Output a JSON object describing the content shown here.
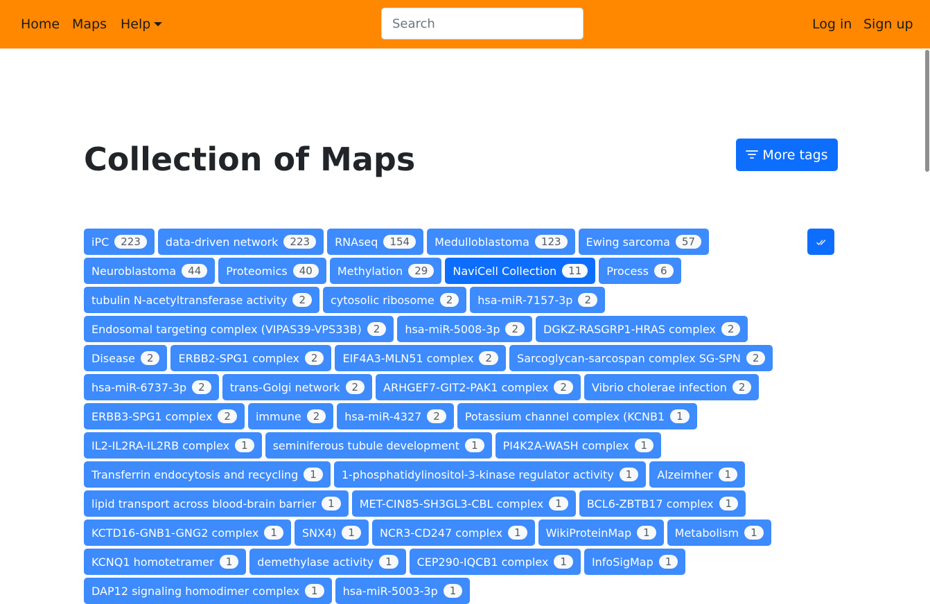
{
  "navbar": {
    "home": "Home",
    "maps": "Maps",
    "help": "Help",
    "search_placeholder": "Search",
    "login": "Log in",
    "signup": "Sign up",
    "bg_color": "#ff8800"
  },
  "page": {
    "title": "Collection of Maps",
    "more_tags_label": "More tags"
  },
  "tags": [
    {
      "label": "iPC",
      "count": "223"
    },
    {
      "label": "data-driven network",
      "count": "223"
    },
    {
      "label": "RNAseq",
      "count": "154"
    },
    {
      "label": "Medulloblastoma",
      "count": "123"
    },
    {
      "label": "Ewing sarcoma",
      "count": "57"
    },
    {
      "label": "Neuroblastoma",
      "count": "44"
    },
    {
      "label": "Proteomics",
      "count": "40"
    },
    {
      "label": "Methylation",
      "count": "29"
    },
    {
      "label": "NaviCell Collection",
      "count": "11",
      "active": true
    },
    {
      "label": "Process",
      "count": "6"
    },
    {
      "label": "tubulin N-acetyltransferase activity",
      "count": "2"
    },
    {
      "label": "cytosolic ribosome",
      "count": "2"
    },
    {
      "label": "hsa-miR-7157-3p",
      "count": "2"
    },
    {
      "label": "Endosomal targeting complex (VIPAS39-VPS33B)",
      "count": "2"
    },
    {
      "label": "hsa-miR-5008-3p",
      "count": "2"
    },
    {
      "label": "DGKZ-RASGRP1-HRAS complex",
      "count": "2"
    },
    {
      "label": "Disease",
      "count": "2"
    },
    {
      "label": "ERBB2-SPG1 complex",
      "count": "2"
    },
    {
      "label": "EIF4A3-MLN51 complex",
      "count": "2"
    },
    {
      "label": "Sarcoglycan-sarcospan complex SG-SPN",
      "count": "2"
    },
    {
      "label": "hsa-miR-6737-3p",
      "count": "2"
    },
    {
      "label": "trans-Golgi network",
      "count": "2"
    },
    {
      "label": "ARHGEF7-GIT2-PAK1 complex",
      "count": "2"
    },
    {
      "label": "Vibrio cholerae infection",
      "count": "2"
    },
    {
      "label": "ERBB3-SPG1 complex",
      "count": "2"
    },
    {
      "label": "immune",
      "count": "2"
    },
    {
      "label": "hsa-miR-4327",
      "count": "2"
    },
    {
      "label": "Potassium channel complex (KCNB1",
      "count": "1"
    },
    {
      "label": "IL2-IL2RA-IL2RB complex",
      "count": "1"
    },
    {
      "label": "seminiferous tubule development",
      "count": "1"
    },
    {
      "label": "PI4K2A-WASH complex",
      "count": "1"
    },
    {
      "label": "Transferrin endocytosis and recycling",
      "count": "1"
    },
    {
      "label": "1-phosphatidylinositol-3-kinase regulator activity",
      "count": "1"
    },
    {
      "label": "Alzeimher",
      "count": "1"
    },
    {
      "label": "lipid transport across blood-brain barrier",
      "count": "1"
    },
    {
      "label": "MET-CIN85-SH3GL3-CBL complex",
      "count": "1"
    },
    {
      "label": "BCL6-ZBTB17 complex",
      "count": "1"
    },
    {
      "label": "KCTD16-GNB1-GNG2 complex",
      "count": "1"
    },
    {
      "label": "SNX4)",
      "count": "1"
    },
    {
      "label": "NCR3-CD247 complex",
      "count": "1"
    },
    {
      "label": "WikiProteinMap",
      "count": "1"
    },
    {
      "label": "Metabolism",
      "count": "1"
    },
    {
      "label": "KCNQ1 homotetramer",
      "count": "1"
    },
    {
      "label": "demethylase activity",
      "count": "1"
    },
    {
      "label": "CEP290-IQCB1 complex",
      "count": "1"
    },
    {
      "label": "InfoSigMap",
      "count": "1"
    },
    {
      "label": "DAP12 signaling homodimer complex",
      "count": "1"
    },
    {
      "label": "hsa-miR-5003-3p",
      "count": "1"
    }
  ],
  "colors": {
    "tag_bg": "#3d8bfd",
    "tag_active_bg": "#0d6efd",
    "primary_button": "#0d6efd"
  },
  "icons": {
    "more_tags": "filter-icon",
    "select_all": "double-check-icon",
    "help_menu": "caret-down-icon"
  }
}
